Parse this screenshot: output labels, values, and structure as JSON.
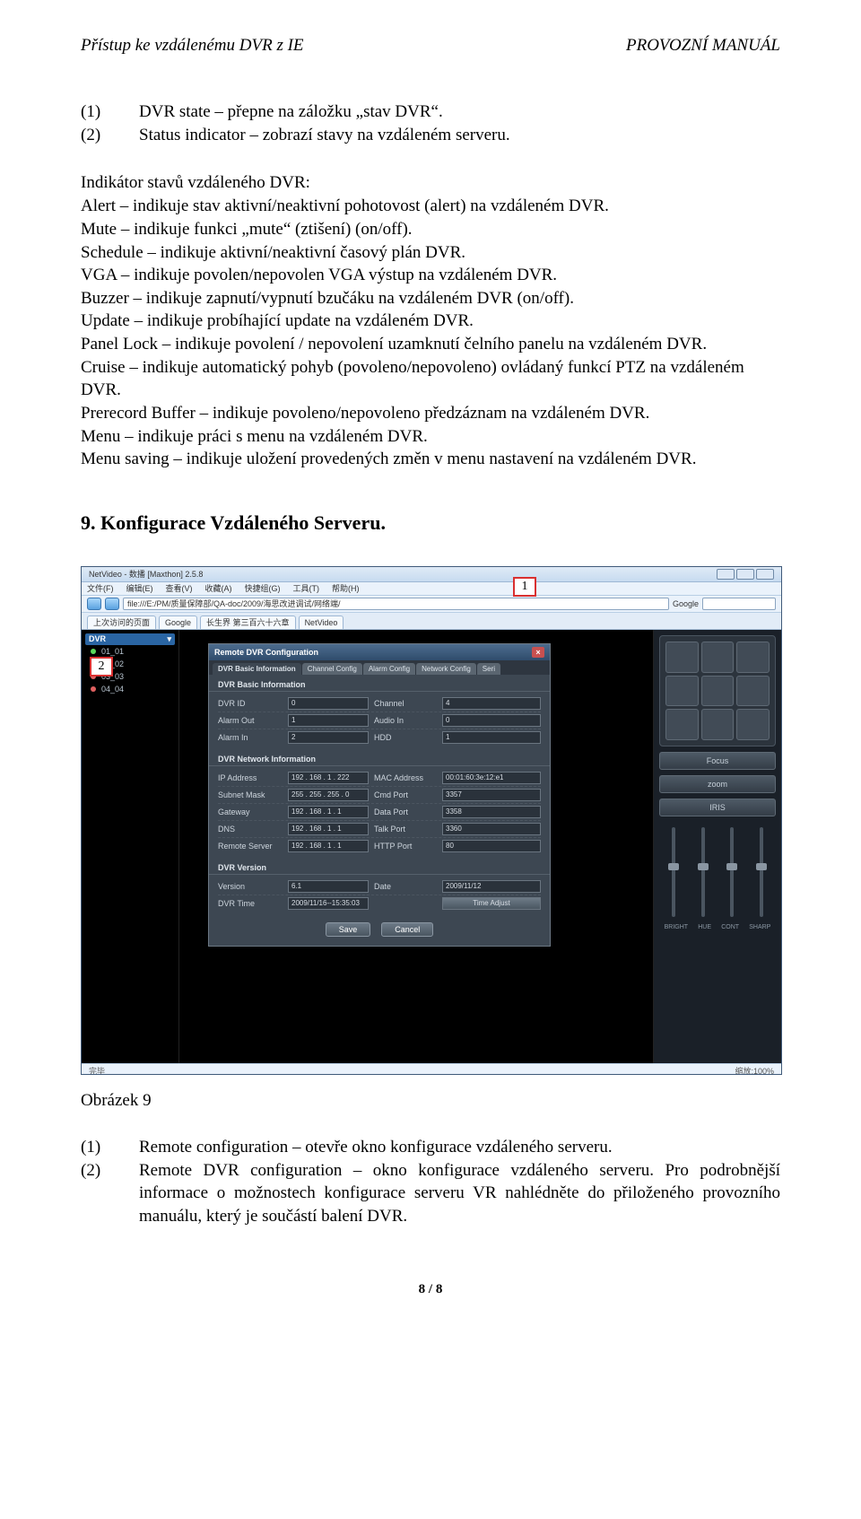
{
  "header": {
    "left": "Přístup ke vzdálenému DVR z IE",
    "right": "PROVOZNÍ MANUÁL"
  },
  "list1": [
    {
      "num": "(1)",
      "text": "DVR state – přepne na záložku „stav DVR“."
    },
    {
      "num": "(2)",
      "text": "Status indicator – zobrazí stavy na vzdáleném serveru."
    }
  ],
  "subhead": "Indikátor stavů vzdáleného DVR:",
  "body_lines": [
    "Alert – indikuje stav aktivní/neaktivní pohotovost (alert) na vzdáleném DVR.",
    "Mute – indikuje funkci „mute“ (ztišení) (on/off).",
    "Schedule – indikuje  aktivní/neaktivní časový plán DVR.",
    "VGA – indikuje povolen/nepovolen VGA výstup na vzdáleném DVR.",
    "Buzzer – indikuje zapnutí/vypnutí bzučáku na vzdáleném DVR (on/off).",
    "Update – indikuje probíhající update na vzdáleném DVR.",
    "Panel Lock – indikuje povolení / nepovolení uzamknutí čelního panelu na vzdáleném DVR.",
    "Cruise – indikuje automatický pohyb (povoleno/nepovoleno) ovládaný funkcí PTZ na vzdáleném DVR.",
    "Prerecord Buffer – indikuje povoleno/nepovoleno předzáznam na vzdáleném DVR.",
    "Menu – indikuje práci s menu na vzdáleném DVR.",
    "Menu saving – indikuje uložení provedených změn v menu nastavení na vzdáleném DVR."
  ],
  "section_title": "9. Konfigurace Vzdáleného Serveru.",
  "screenshot": {
    "titlebar": "NetVideo - 数播 [Maxthon] 2.5.8",
    "menubar": [
      "文件(F)",
      "编辑(E)",
      "查看(V)",
      "收藏(A)",
      "快捷组(G)",
      "工具(T)",
      "帮助(H)"
    ],
    "address": "file:///E:/PM/质量保障部/QA-doc/2009/海思改进调试/网络端/",
    "tabs": [
      "上次访问的页面",
      "Google",
      "长生界 第三百六十六章",
      "NetVideo"
    ],
    "marker1": "1",
    "marker2": "2",
    "tree_header": "DVR",
    "tree_items": [
      "01_01",
      "02_02",
      "03_03",
      "04_04"
    ],
    "dialog": {
      "title": "Remote DVR Configuration",
      "tabs": [
        "DVR Basic Information",
        "Channel Config",
        "Alarm Config",
        "Network Config",
        "Seri"
      ],
      "sections": {
        "basic": "DVR Basic Information",
        "net": "DVR Network Information",
        "ver": "DVR Version"
      },
      "fields": {
        "dvr_id": {
          "label": "DVR ID",
          "value": "0"
        },
        "channel": {
          "label": "Channel",
          "value": "4"
        },
        "alarm_out": {
          "label": "Alarm Out",
          "value": "1"
        },
        "audio_in": {
          "label": "Audio In",
          "value": "0"
        },
        "alarm_in": {
          "label": "Alarm In",
          "value": "2"
        },
        "hdd": {
          "label": "HDD",
          "value": "1"
        },
        "ip": {
          "label": "IP Address",
          "value": "192 . 168 .  1  . 222"
        },
        "mac": {
          "label": "MAC Address",
          "value": "00:01:60:3e:12:e1"
        },
        "subnet": {
          "label": "Subnet Mask",
          "value": "255 . 255 . 255 .  0"
        },
        "cmd_port": {
          "label": "Cmd Port",
          "value": "3357"
        },
        "gateway": {
          "label": "Gateway",
          "value": "192 . 168 .  1  .  1"
        },
        "data_port": {
          "label": "Data Port",
          "value": "3358"
        },
        "dns": {
          "label": "DNS",
          "value": "192 . 168 .  1  .  1"
        },
        "talk_port": {
          "label": "Talk Port",
          "value": "3360"
        },
        "remote_server": {
          "label": "Remote Server",
          "value": "192 . 168 .  1  .  1"
        },
        "http_port": {
          "label": "HTTP Port",
          "value": "80"
        },
        "version": {
          "label": "Version",
          "value": "6.1"
        },
        "date": {
          "label": "Date",
          "value": "2009/11/12"
        },
        "dvr_time": {
          "label": "DVR Time",
          "value": "2009/11/16--15:35:03"
        },
        "time_adjust": {
          "label": "",
          "value": "Time Adjust"
        }
      },
      "buttons": {
        "save": "Save",
        "cancel": "Cancel"
      }
    },
    "ptz_labels": {
      "focus": "Focus",
      "zoom": "zoom",
      "iris": "IRIS"
    },
    "slider_labels": [
      "BRIGHT",
      "HUE",
      "CONT",
      "SHARP"
    ],
    "statusbar_left": "完毕",
    "statusbar_right": "缩放:100%"
  },
  "result_label": "Obrázek 9",
  "list2": [
    {
      "num": "(1)",
      "text": "Remote configuration – otevře okno konfigurace vzdáleného serveru."
    },
    {
      "num": "(2)",
      "text": "Remote DVR configuration – okno konfigurace vzdáleného serveru. Pro podrobnější informace o možnostech konfigurace serveru VR nahlédněte do přiloženého provozního manuálu, který je součástí balení DVR."
    }
  ],
  "footer": "8 / 8"
}
